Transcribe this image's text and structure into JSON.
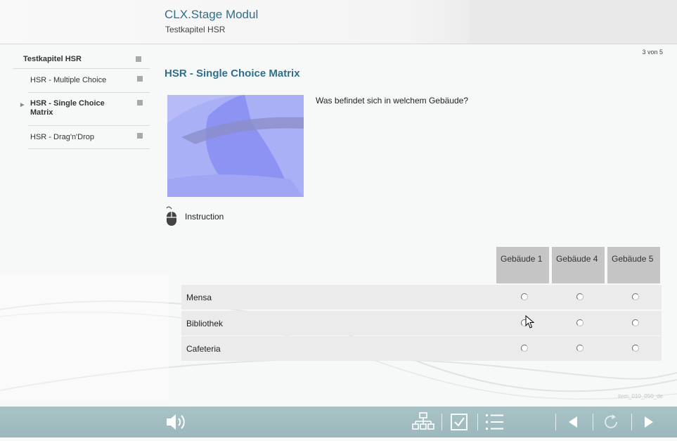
{
  "header": {
    "title": "CLX.Stage Modul",
    "subtitle": "Testkapitel HSR"
  },
  "sidebar": {
    "chapter": "Testkapitel HSR",
    "items": [
      {
        "label": "HSR - Multiple Choice",
        "active": false
      },
      {
        "label": "HSR - Single Choice Matrix",
        "active": true
      },
      {
        "label": "HSR - Drag'n'Drop",
        "active": false
      }
    ]
  },
  "content": {
    "page_count": "3 von 5",
    "title": "HSR - Single Choice Matrix",
    "question": "Was befindet sich in welchem Gebäude?",
    "instruction": "Instruction",
    "columns": [
      "Gebäude 1",
      "Gebäude 4",
      "Gebäude 5"
    ],
    "rows": [
      "Mensa",
      "Bibliothek",
      "Cafeteria"
    ],
    "item_id": "item_010_050_de"
  },
  "icons": {
    "mouse": "mouse-icon",
    "speaker": "speaker-icon",
    "sitemap": "sitemap-icon",
    "checkbox": "checkbox-icon",
    "list": "list-icon",
    "prev": "arrow-left-icon",
    "reload": "reload-icon",
    "next": "arrow-right-icon"
  },
  "colors": {
    "accent": "#2f6f8c",
    "toolbar": "#a3bec1",
    "header_cell": "#c5c5c5",
    "row_bg": "#ebebeb"
  }
}
